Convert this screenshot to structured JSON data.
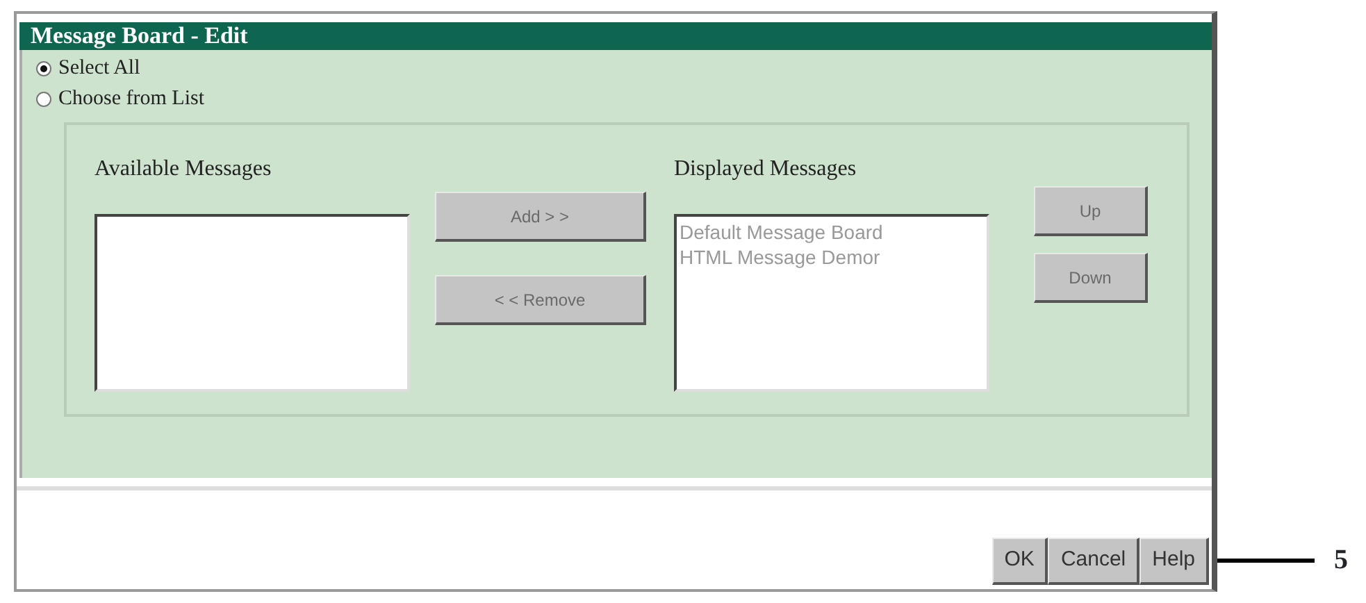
{
  "window": {
    "title": "Message Board - Edit"
  },
  "options": [
    {
      "label": "Select All",
      "selected": true
    },
    {
      "label": "Choose from List",
      "selected": false
    }
  ],
  "available_messages": {
    "label": "Available Messages"
  },
  "move_buttons": [
    {
      "label": "Add > >",
      "disabled": true
    },
    {
      "label": "< < Remove",
      "disabled": true
    }
  ],
  "displayed_messages": {
    "label": "Displayed Messages",
    "items": [
      "Default Message Board",
      "HTML Message Demor"
    ],
    "disabled": true
  },
  "order_buttons": [
    {
      "label": "Up",
      "disabled": true
    },
    {
      "label": "Down",
      "disabled": true
    }
  ],
  "footer_buttons": [
    {
      "label": "OK"
    },
    {
      "label": "Cancel"
    },
    {
      "label": "Help"
    }
  ],
  "callout": {
    "label": "5"
  }
}
